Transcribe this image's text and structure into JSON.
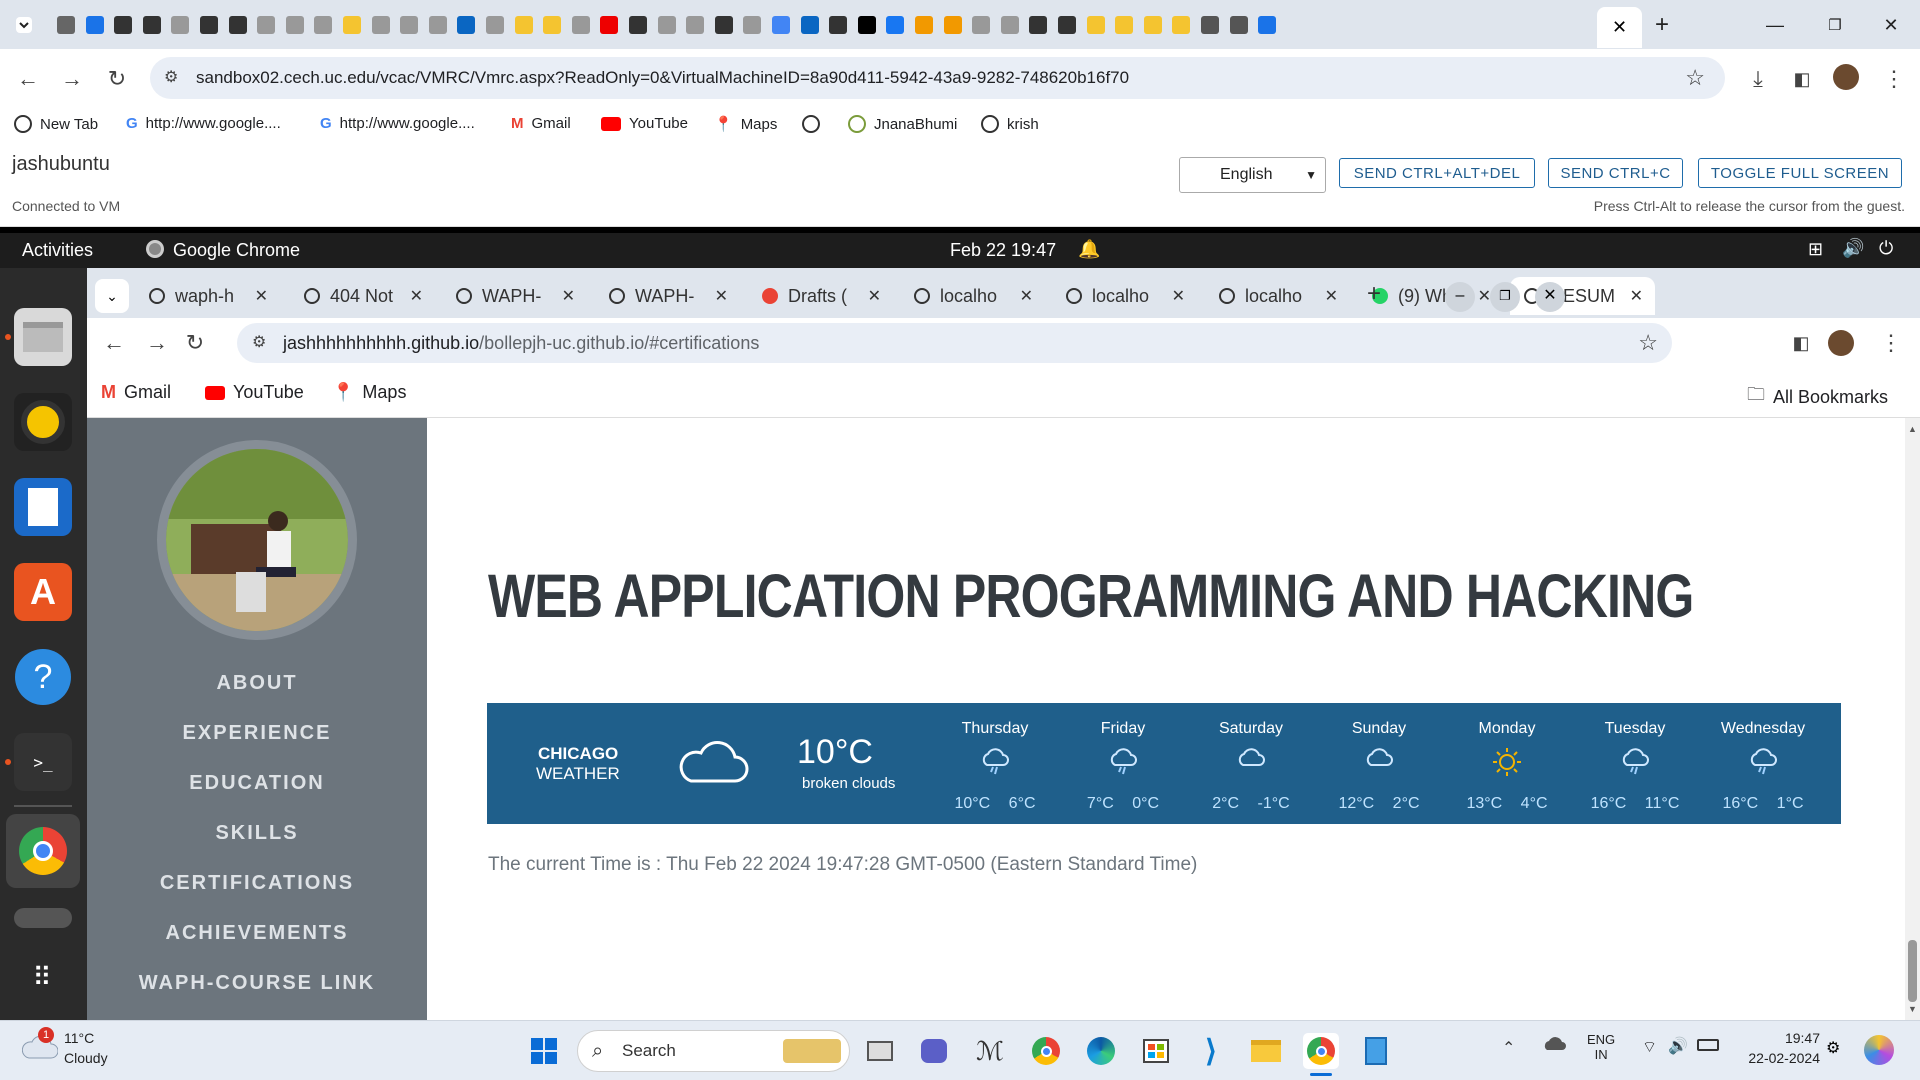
{
  "outer_browser": {
    "url": "sandbox02.cech.uc.edu/vcac/VMRC/Vmrc.aspx?ReadOnly=0&VirtualMachineID=8a90d411-5942-43a9-9282-748620b16f70",
    "bookmarks": [
      "New Tab",
      "http://www.google....",
      "http://www.google....",
      "Gmail",
      "YouTube",
      "Maps",
      "",
      "JnanaBhumi",
      "krish"
    ]
  },
  "vmrc": {
    "title": "jashubuntu",
    "status": "Connected to VM",
    "language": "English",
    "buttons": [
      "SEND CTRL+ALT+DEL",
      "SEND CTRL+C",
      "TOGGLE FULL SCREEN"
    ],
    "hint": "Press Ctrl-Alt to release the cursor from the guest."
  },
  "ubuntu": {
    "activities": "Activities",
    "app": "Google Chrome",
    "clock": "Feb 22  19:47"
  },
  "inner_browser": {
    "tabs": [
      "waph-h",
      "404 Not",
      "WAPH-",
      "WAPH-",
      "Drafts (",
      "localho",
      "localho",
      "localho",
      "(9) Wha",
      "RESUM"
    ],
    "url_host": "jashhhhhhhhhh.github.io",
    "url_path": "/bollepjh-uc.github.io/#certifications",
    "bookmarks": [
      "Gmail",
      "YouTube",
      "Maps"
    ],
    "all_bookmarks": "All Bookmarks"
  },
  "sidebar": {
    "nav": [
      "ABOUT",
      "EXPERIENCE",
      "EDUCATION",
      "SKILLS",
      "CERTIFICATIONS",
      "ACHIEVEMENTS",
      "WAPH-COURSE LINK"
    ]
  },
  "page": {
    "heading": "WEB APPLICATION PROGRAMMING AND HACKING",
    "weather": {
      "city": "CHICAGO",
      "label": "WEATHER",
      "temp": "10°C",
      "desc": "broken clouds",
      "days": [
        {
          "name": "Thursday",
          "temps": "10°C 6°C",
          "icon": "rain-cloud-icon"
        },
        {
          "name": "Friday",
          "temps": "7°C 0°C",
          "icon": "rain-cloud-icon"
        },
        {
          "name": "Saturday",
          "temps": "2°C -1°C",
          "icon": "cloud-icon"
        },
        {
          "name": "Sunday",
          "temps": "12°C 2°C",
          "icon": "cloud-icon"
        },
        {
          "name": "Monday",
          "temps": "13°C 4°C",
          "icon": "sun-icon"
        },
        {
          "name": "Tuesday",
          "temps": "16°C 11°C",
          "icon": "rain-cloud-icon"
        },
        {
          "name": "Wednesday",
          "temps": "16°C 1°C",
          "icon": "rain-cloud-icon"
        }
      ]
    },
    "current_time": "The current Time is : Thu Feb 22 2024 19:47:28 GMT-0500 (Eastern Standard Time)"
  },
  "taskbar": {
    "weather_temp": "11°C",
    "weather_desc": "Cloudy",
    "weather_badge": "1",
    "search": "Search",
    "lang_top": "ENG",
    "lang_bottom": "IN",
    "time": "19:47",
    "date": "22-02-2024"
  },
  "colors": {
    "weather_bg": "#1f5f8b",
    "sidebar_bg": "#6c757d",
    "accent": "#1a73e8"
  }
}
